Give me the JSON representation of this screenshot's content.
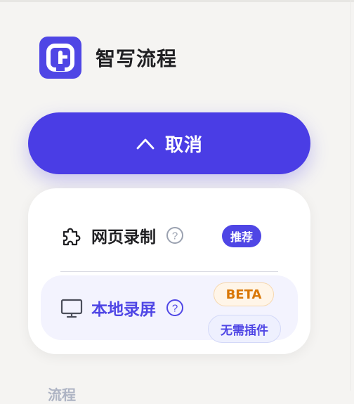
{
  "app": {
    "name": "智写流程"
  },
  "cancel_button": {
    "label": "取消"
  },
  "menu": {
    "items": [
      {
        "label": "网页录制",
        "badges": [
          "推荐"
        ]
      },
      {
        "label": "本地录屏",
        "badges": [
          "BETA",
          "无需插件"
        ]
      }
    ]
  },
  "sidebar": {
    "section_label": "流程"
  },
  "colors": {
    "accent": "#4f46e5",
    "beta": "#d97706"
  }
}
